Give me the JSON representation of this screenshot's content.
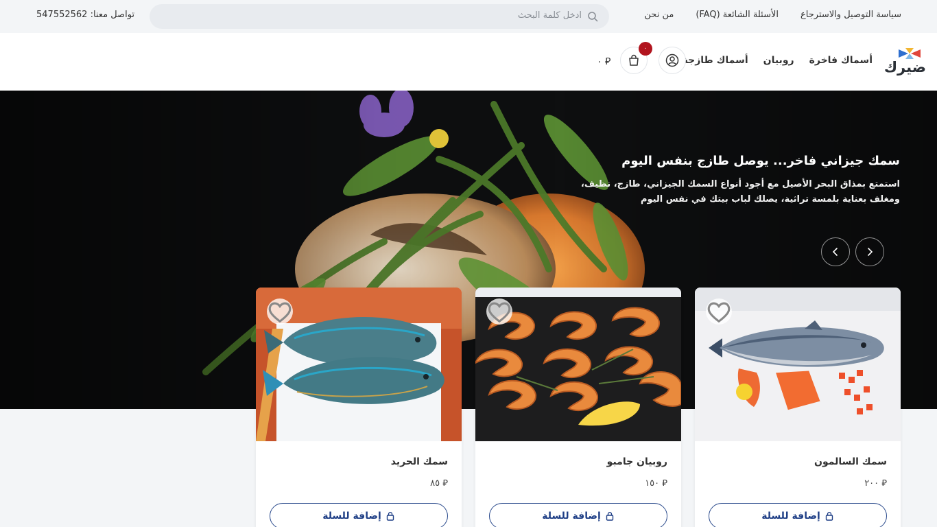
{
  "topbar": {
    "contact": "تواصل معنا: 547552562",
    "search_placeholder": "ادخل كلمة البحث",
    "links": [
      "من نحن",
      "الأسئلة الشائعة (FAQ)",
      "سياسة التوصيل والاسترجاع"
    ]
  },
  "header": {
    "logo_text": "ضيرك",
    "nav": [
      "أسماك طازجة",
      "روبيان",
      "أسماك فاخرة"
    ],
    "cart_badge": "٠",
    "cart_total": "⃁ ٠"
  },
  "hero": {
    "title": "سمك جيزاني فاخر... يوصل طازج بنفس اليوم",
    "subtitle": "استمتع بمذاق البحر الأصيل مع أجود أنواع السمك الجيزاني، طازج، نظيف، ومغلف بعناية بلمسة تراثية، يصلك لباب بيتك في نفس اليوم"
  },
  "products": [
    {
      "name": "سمك السالمون",
      "price": "⃁ ٢٠٠",
      "button": "إضافة للسلة"
    },
    {
      "name": "روبيان جامبو",
      "price": "⃁ ١٥٠",
      "button": "إضافة للسلة"
    },
    {
      "name": "سمك الحريد",
      "price": "⃁ ٨٥",
      "button": "إضافة للسلة"
    }
  ],
  "colors": {
    "accent": "#1f3f86",
    "badge": "#b1141e",
    "background": "#f3f5f7"
  },
  "icons": [
    "search-icon",
    "user-icon",
    "cart-icon",
    "heart-icon",
    "lock-icon",
    "chevron-left-icon",
    "chevron-right-icon"
  ]
}
